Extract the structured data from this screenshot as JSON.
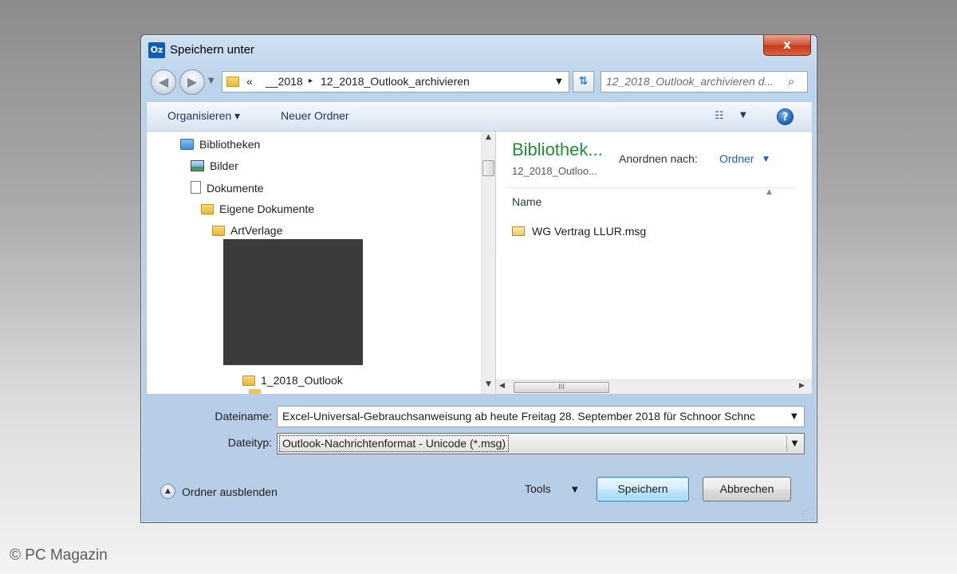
{
  "window": {
    "title": "Speichern unter",
    "app_icon": "Oz",
    "close_label": "x"
  },
  "address": {
    "overflow": "«",
    "crumbs": [
      "__2018",
      "12_2018_Outlook_archivieren"
    ],
    "separator": "▸"
  },
  "search": {
    "placeholder": "12_2018_Outlook_archivieren d..."
  },
  "toolbar": {
    "organize_label": "Organisieren ▾",
    "new_folder_label": "Neuer Ordner",
    "help_label": "?"
  },
  "tree": {
    "items": [
      {
        "label": "Bibliotheken",
        "icon": "library-icon"
      },
      {
        "label": "Bilder",
        "icon": "pictures-icon"
      },
      {
        "label": "Dokumente",
        "icon": "documents-icon"
      },
      {
        "label": "Eigene Dokumente",
        "icon": "folder-icon"
      },
      {
        "label": "ArtVerlage",
        "icon": "folder-icon"
      },
      {
        "label": "1_2018_Outlook",
        "icon": "folder-icon"
      }
    ]
  },
  "content": {
    "title": "Bibliothek...",
    "subtitle": "12_2018_Outloo...",
    "arrange_label": "Anordnen nach:",
    "arrange_value": "Ordner",
    "column_header": "Name",
    "files": [
      {
        "name": "WG Vertrag LLUR.msg",
        "icon": "mail-icon"
      }
    ],
    "scroll_thumb_grip": "III"
  },
  "fields": {
    "filename_label": "Dateiname:",
    "filename_value": "Excel-Universal-Gebrauchsanweisung ab heute Freitag 28. September 2018 für Schnoor Schnc",
    "filetype_label": "Dateityp:",
    "filetype_value": "Outlook-Nachrichtenformat - Unicode (*.msg)"
  },
  "footer": {
    "hide_folders_label": "Ordner ausblenden",
    "tools_label": "Tools",
    "save_label": "Speichern",
    "cancel_label": "Abbrechen"
  },
  "watermark": "© PC Magazin",
  "colors": {
    "content_title": "#1e8d3a",
    "link_blue": "#1c5fb8",
    "close_red": "#c23b1c"
  }
}
